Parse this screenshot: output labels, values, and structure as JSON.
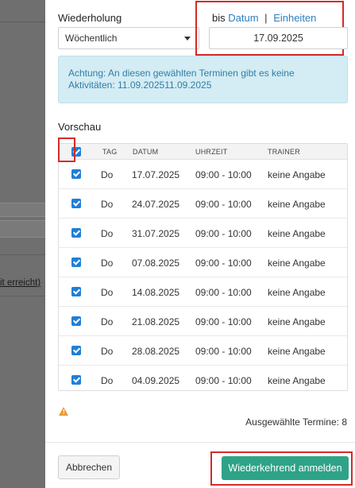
{
  "backdrop": {
    "text": "it erreicht)"
  },
  "form": {
    "repeat_label": "Wiederholung",
    "repeat_value": "Wöchentlich",
    "until_prefix": "bis",
    "until_opt_date": "Datum",
    "until_sep": "|",
    "until_opt_units": "Einheiten",
    "until_date": "17.09.2025"
  },
  "alert": {
    "text": "Achtung: An diesen gewählten Terminen gibt es keine Aktivitäten: 11.09.202511.09.2025"
  },
  "preview": {
    "label": "Vorschau",
    "columns": [
      "TAG",
      "DATUM",
      "UHRZEIT",
      "TRAINER"
    ],
    "rows": [
      {
        "day": "Do",
        "date": "17.07.2025",
        "time": "09:00 - 10:00",
        "trainer": "keine Angabe"
      },
      {
        "day": "Do",
        "date": "24.07.2025",
        "time": "09:00 - 10:00",
        "trainer": "keine Angabe"
      },
      {
        "day": "Do",
        "date": "31.07.2025",
        "time": "09:00 - 10:00",
        "trainer": "keine Angabe"
      },
      {
        "day": "Do",
        "date": "07.08.2025",
        "time": "09:00 - 10:00",
        "trainer": "keine Angabe"
      },
      {
        "day": "Do",
        "date": "14.08.2025",
        "time": "09:00 - 10:00",
        "trainer": "keine Angabe"
      },
      {
        "day": "Do",
        "date": "21.08.2025",
        "time": "09:00 - 10:00",
        "trainer": "keine Angabe"
      },
      {
        "day": "Do",
        "date": "28.08.2025",
        "time": "09:00 - 10:00",
        "trainer": "keine Angabe"
      },
      {
        "day": "Do",
        "date": "04.09.2025",
        "time": "09:00 - 10:00",
        "trainer": "keine Angabe"
      }
    ]
  },
  "summary": {
    "selected": "Ausgewählte Termine: 8"
  },
  "footer": {
    "cancel": "Abbrechen",
    "submit": "Wiederkehrend anmelden"
  },
  "colors": {
    "accent": "#2ea388",
    "link": "#2d7fbf",
    "checkbox": "#1f7fd8",
    "highlight": "#d42a2a",
    "warning": "#e99a3a"
  },
  "icons": {
    "warning": "warning-triangle-icon",
    "dropdown": "chevron-down-icon",
    "checkbox": "checkbox-checked-icon"
  }
}
